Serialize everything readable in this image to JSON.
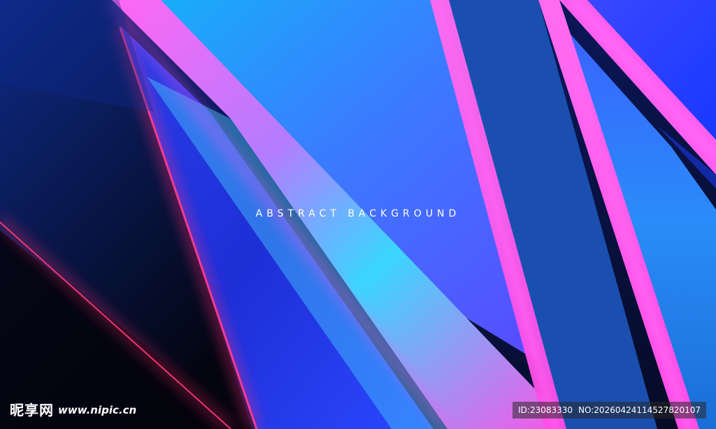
{
  "headline": "ABSTRACT BACKGROUND",
  "watermark": {
    "logo": "昵享网",
    "url": "www.nipic.cn",
    "id_text": "ID:23083330",
    "no_text": "NO:20260424114527820107"
  },
  "colors": {
    "deep_navy": "#040818",
    "dark_blue": "#0a1a5c",
    "royal_blue": "#1a4fb0",
    "sky_blue": "#16b8f8",
    "cyan": "#38d8ff",
    "electric_blue": "#2a3cff",
    "magenta": "#ff3cf0",
    "hot_pink": "#ff2a6a"
  }
}
